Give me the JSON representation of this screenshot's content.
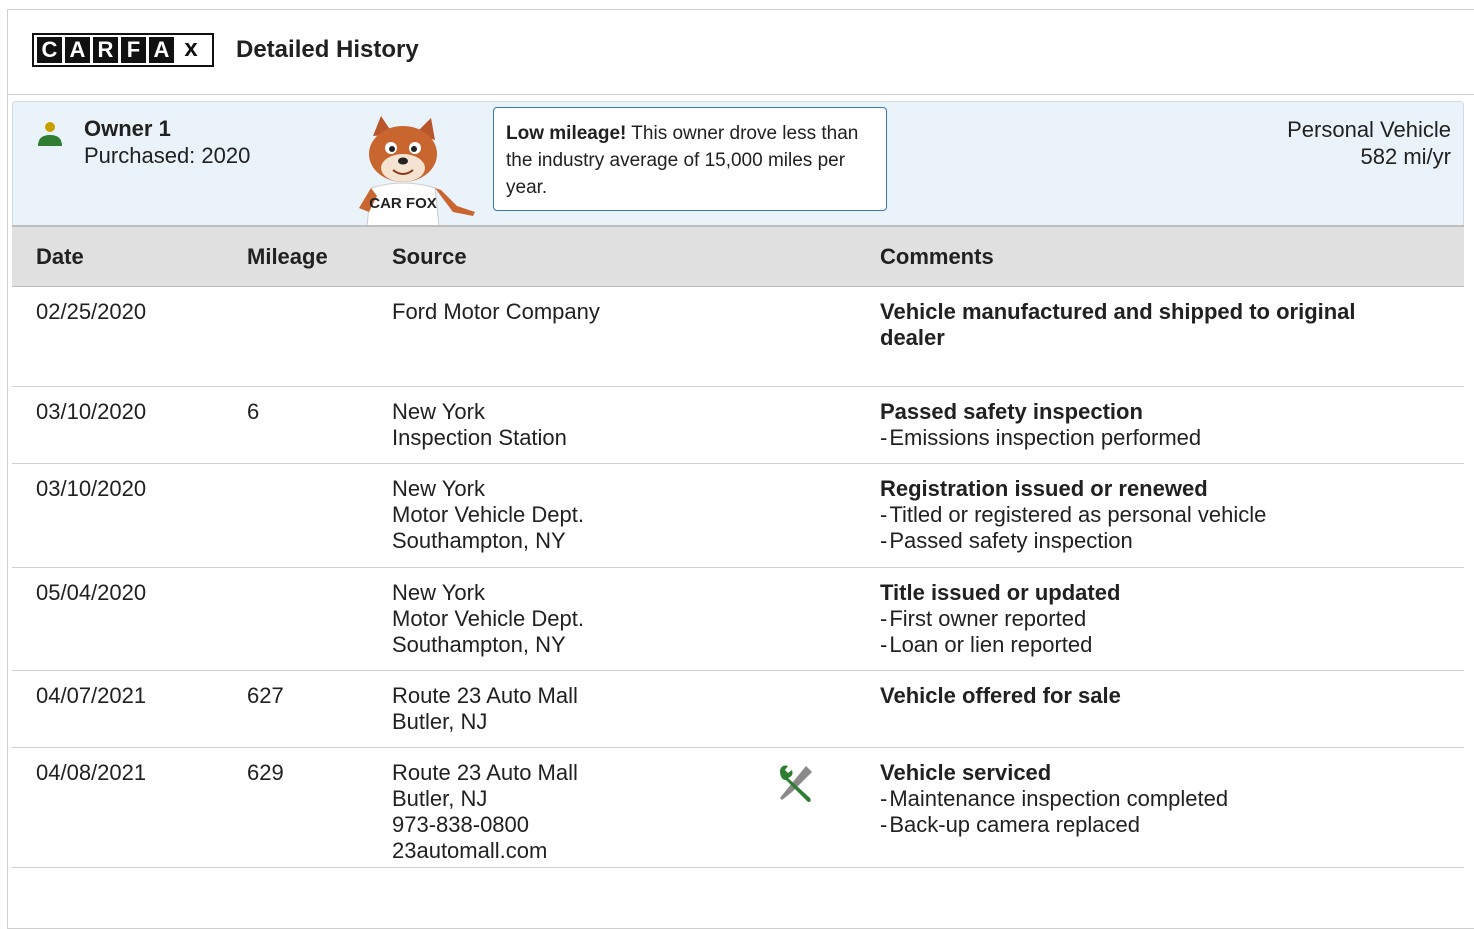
{
  "header": {
    "logo_letters": [
      "C",
      "A",
      "R",
      "F",
      "A",
      "x"
    ],
    "title": "Detailed History"
  },
  "owner": {
    "name": "Owner 1",
    "purchased": "Purchased: 2020",
    "callout_bold": "Low mileage!",
    "callout_text": " This owner drove less than the industry average of 15,000 miles per year.",
    "vehicle_type": "Personal Vehicle",
    "miles_per_year": "582 mi/yr",
    "fox_shirt": "CAR FOX",
    "colors": {
      "panel_bg": "#eaf3fa",
      "callout_border": "#3777bc",
      "person_icon": "#2e7d32",
      "person_head": "#c8a000"
    }
  },
  "table": {
    "headers": [
      "Date",
      "Mileage",
      "Source",
      "Comments"
    ],
    "rows": [
      {
        "date": "02/25/2020",
        "mileage": "",
        "source": [
          "Ford Motor Company"
        ],
        "icon": "",
        "title": "Vehicle manufactured and shipped to original dealer",
        "items": []
      },
      {
        "date": "03/10/2020",
        "mileage": "6",
        "source": [
          "New York",
          "Inspection Station"
        ],
        "icon": "",
        "title": "Passed safety inspection",
        "items": [
          "Emissions inspection performed"
        ]
      },
      {
        "date": "03/10/2020",
        "mileage": "",
        "source": [
          "New York",
          "Motor Vehicle Dept.",
          "Southampton, NY"
        ],
        "icon": "",
        "title": "Registration issued or renewed",
        "items": [
          "Titled or registered as personal vehicle",
          "Passed safety inspection"
        ]
      },
      {
        "date": "05/04/2020",
        "mileage": "",
        "source": [
          "New York",
          "Motor Vehicle Dept.",
          "Southampton, NY"
        ],
        "icon": "",
        "title": "Title issued or updated",
        "items": [
          "First owner reported",
          "Loan or lien reported"
        ]
      },
      {
        "date": "04/07/2021",
        "mileage": "627",
        "source": [
          "Route 23 Auto Mall",
          "Butler, NJ"
        ],
        "icon": "",
        "title": "Vehicle offered for sale",
        "items": []
      },
      {
        "date": "04/08/2021",
        "mileage": "629",
        "source": [
          "Route 23 Auto Mall",
          "Butler, NJ",
          "973-838-0800",
          "23automall.com"
        ],
        "icon": "wrench-screwdriver-icon",
        "title": "Vehicle serviced",
        "items": [
          "Maintenance inspection completed",
          "Back-up camera replaced"
        ]
      }
    ]
  }
}
